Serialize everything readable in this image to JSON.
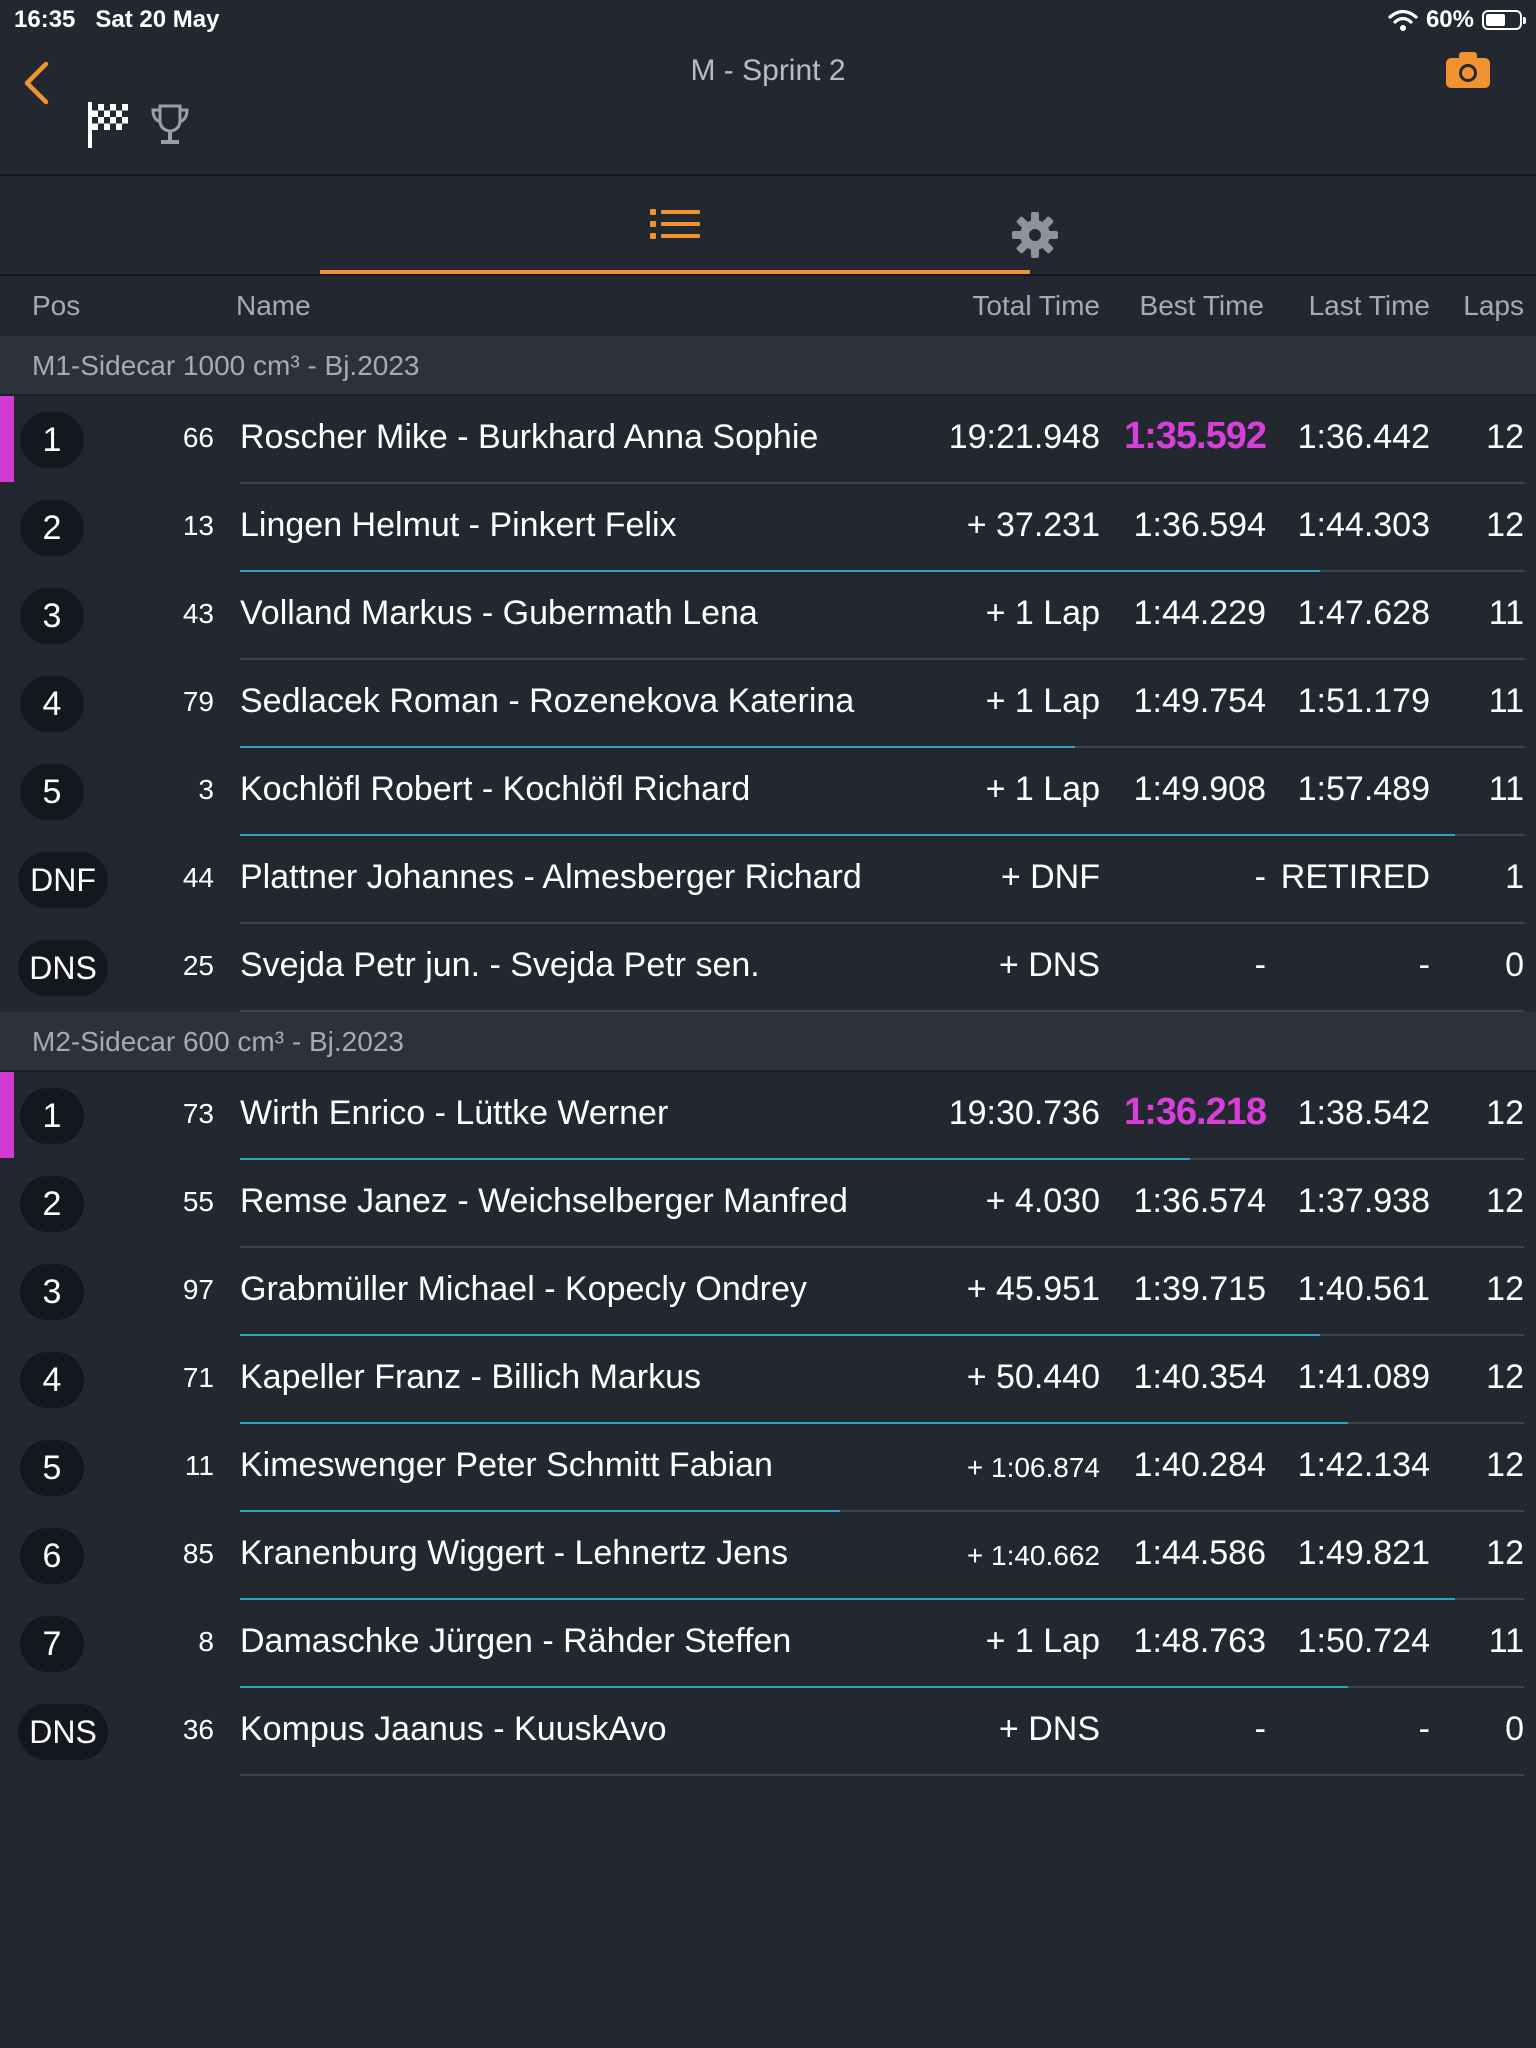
{
  "status": {
    "time": "16:35",
    "date": "Sat 20 May",
    "battery": "60%",
    "battery_level": 0.6
  },
  "nav": {
    "title": "M - Sprint 2"
  },
  "icons": {
    "back": "chevron-left-icon",
    "camera": "camera-icon",
    "flag": "checkered-flag-icon",
    "trophy": "trophy-icon",
    "list": "list-icon",
    "settings": "gear-icon"
  },
  "colors": {
    "accent": "#f0922e",
    "fastest": "#d83ed8",
    "progress": "#2aa4c2",
    "background": "#232730"
  },
  "columns": {
    "pos": "Pos",
    "name": "Name",
    "total": "Total Time",
    "best": "Best Time",
    "last": "Last Time",
    "laps": "Laps"
  },
  "groups": [
    {
      "title": "M1-Sidecar 1000 cm³ - Bj.2023",
      "rows": [
        {
          "pos": "1",
          "num": "66",
          "name": "Roscher Mike - Burkhard Anna Sophie",
          "total": "19:21.948",
          "best": "1:35.592",
          "last": "1:36.442",
          "laps": "12"
        },
        {
          "pos": "2",
          "num": "13",
          "name": "Lingen  Helmut - Pinkert Felix",
          "total": "+ 37.231",
          "best": "1:36.594",
          "last": "1:44.303",
          "laps": "12"
        },
        {
          "pos": "3",
          "num": "43",
          "name": "Volland Markus - Gubermath Lena",
          "total": "+ 1 Lap",
          "best": "1:44.229",
          "last": "1:47.628",
          "laps": "11"
        },
        {
          "pos": "4",
          "num": "79",
          "name": "Sedlacek  Roman - Rozenekova  Katerina",
          "total": "+ 1 Lap",
          "best": "1:49.754",
          "last": "1:51.179",
          "laps": "11"
        },
        {
          "pos": "5",
          "num": "3",
          "name": "Kochlöfl  Robert - Kochlöfl Richard",
          "total": "+ 1 Lap",
          "best": "1:49.908",
          "last": "1:57.489",
          "laps": "11"
        },
        {
          "pos": "DNF",
          "num": "44",
          "name": "Plattner Johannes - Almesberger Richard",
          "total": "+ DNF",
          "best": "-",
          "last": "RETIRED",
          "laps": "1"
        },
        {
          "pos": "DNS",
          "num": "25",
          "name": "Svejda  Petr jun. - Svejda Petr sen.",
          "total": "+ DNS",
          "best": "-",
          "last": "-",
          "laps": "0"
        }
      ]
    },
    {
      "title": "M2-Sidecar 600 cm³ - Bj.2023",
      "rows": [
        {
          "pos": "1",
          "num": "73",
          "name": "Wirth  Enrico - Lüttke Werner",
          "total": "19:30.736",
          "best": "1:36.218",
          "last": "1:38.542",
          "laps": "12"
        },
        {
          "pos": "2",
          "num": "55",
          "name": "Remse  Janez - Weichselberger Manfred",
          "total": "+ 4.030",
          "best": "1:36.574",
          "last": "1:37.938",
          "laps": "12"
        },
        {
          "pos": "3",
          "num": "97",
          "name": "Grabmüller  Michael - Kopecly Ondrey",
          "total": "+ 45.951",
          "best": "1:39.715",
          "last": "1:40.561",
          "laps": "12"
        },
        {
          "pos": "4",
          "num": "71",
          "name": "Kapeller  Franz - Billich Markus",
          "total": "+ 50.440",
          "best": "1:40.354",
          "last": "1:41.089",
          "laps": "12"
        },
        {
          "pos": "5",
          "num": "11",
          "name": "Kimeswenger Peter Schmitt Fabian",
          "total": "+ 1:06.874",
          "best": "1:40.284",
          "last": "1:42.134",
          "laps": "12"
        },
        {
          "pos": "6",
          "num": "85",
          "name": "Kranenburg Wiggert - Lehnertz Jens",
          "total": "+ 1:40.662",
          "best": "1:44.586",
          "last": "1:49.821",
          "laps": "12"
        },
        {
          "pos": "7",
          "num": "8",
          "name": "Damaschke  Jürgen - Rähder Steffen",
          "total": "+ 1 Lap",
          "best": "1:48.763",
          "last": "1:50.724",
          "laps": "11"
        },
        {
          "pos": "DNS",
          "num": "36",
          "name": "Kompus Jaanus - KuuskAvo",
          "total": "+ DNS",
          "best": "-",
          "last": "-",
          "laps": "0"
        }
      ]
    }
  ]
}
